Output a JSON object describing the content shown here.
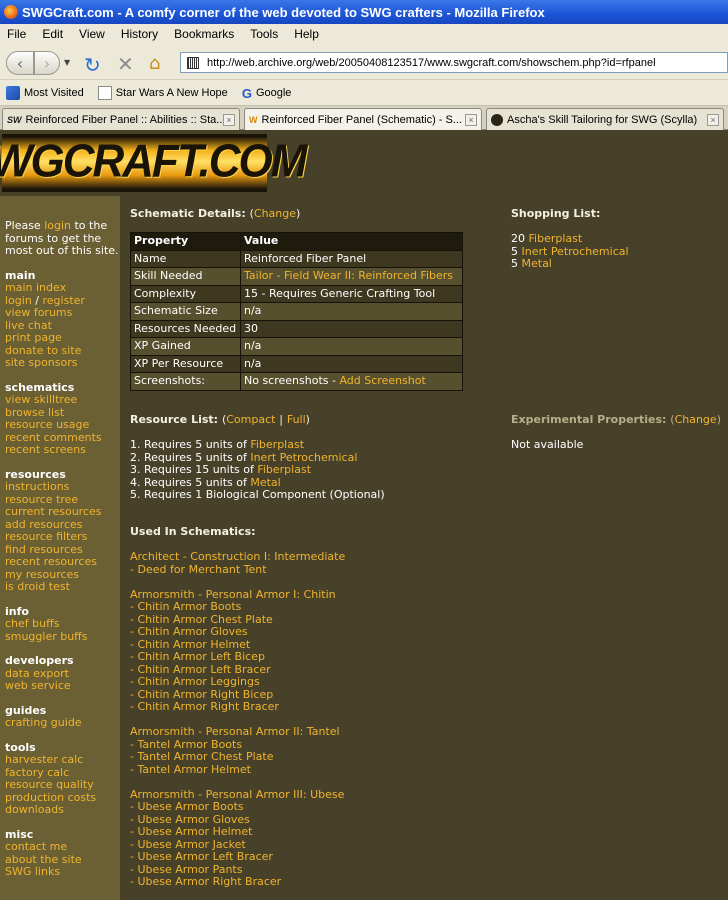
{
  "browser": {
    "window_title": "SWGCraft.com - A comfy corner of the web devoted to SWG crafters - Mozilla Firefox",
    "menu": [
      "File",
      "Edit",
      "View",
      "History",
      "Bookmarks",
      "Tools",
      "Help"
    ],
    "url": "http://web.archive.org/web/20050408123517/www.swgcraft.com/showschem.php?id=rfpanel",
    "bookmarks": [
      "Most Visited",
      "Star Wars A New Hope",
      "Google"
    ],
    "tabs": [
      {
        "fav": "SW",
        "title": "Reinforced Fiber Panel :: Abilities :: Sta..."
      },
      {
        "fav": "W",
        "title": "Reinforced Fiber Panel (Schematic) - S..."
      },
      {
        "fav": "",
        "title": "Ascha's Skill Tailoring for SWG (Scylla)"
      }
    ],
    "nav_glyphs": {
      "back": "‹",
      "forward": "›",
      "dropdown": "▼",
      "reload": "↻",
      "stop": "✕",
      "home": "⌂",
      "tab_close": "×"
    }
  },
  "site": {
    "logo_text": "SWGCRAFT.COM",
    "sidebar": {
      "intro_pre": "Please ",
      "intro_link": "login",
      "intro_post": " to the forums to get the most out of this site.",
      "sections": [
        {
          "title": "main",
          "items": [
            "main index",
            "login / register",
            "view forums",
            "live chat",
            "print page",
            "donate to site",
            "site sponsors"
          ]
        },
        {
          "title": "schematics",
          "items": [
            "view skilltree",
            "browse list",
            "resource usage",
            "recent comments",
            "recent screens"
          ]
        },
        {
          "title": "resources",
          "items": [
            "instructions",
            "resource tree",
            "current resources",
            "add resources",
            "resource filters",
            "find resources",
            "recent resources",
            "my resources",
            "is droid test"
          ]
        },
        {
          "title": "info",
          "items": [
            "chef buffs",
            "smuggler buffs"
          ]
        },
        {
          "title": "developers",
          "items": [
            "data export",
            "web service"
          ]
        },
        {
          "title": "guides",
          "items": [
            "crafting guide"
          ]
        },
        {
          "title": "tools",
          "items": [
            "harvester calc",
            "factory calc",
            "resource quality",
            "production costs",
            "downloads"
          ]
        },
        {
          "title": "misc",
          "items": [
            "contact me",
            "about the site",
            "SWG links"
          ]
        }
      ]
    },
    "details": {
      "heading": "Schematic Details:",
      "change_open": "(",
      "change": "Change",
      "change_close": ")",
      "col_property": "Property",
      "col_value": "Value",
      "rows": [
        {
          "p": "Name",
          "v": "Reinforced Fiber Panel",
          "link": ""
        },
        {
          "p": "Skill Needed",
          "v": "",
          "link": "Tailor - Field Wear II: Reinforced Fibers"
        },
        {
          "p": "Complexity",
          "v": "15 - Requires Generic Crafting Tool",
          "link": ""
        },
        {
          "p": "Schematic Size",
          "v": "n/a",
          "link": ""
        },
        {
          "p": "Resources Needed",
          "v": "30",
          "link": ""
        },
        {
          "p": "XP Gained",
          "v": "n/a",
          "link": ""
        },
        {
          "p": "XP Per Resource",
          "v": "n/a",
          "link": ""
        },
        {
          "p": "Screenshots:",
          "v": "No screenshots - ",
          "link": "Add Screenshot"
        }
      ]
    },
    "shopping": {
      "heading": "Shopping List:",
      "items": [
        {
          "qty": "20",
          "name": "Fiberplast"
        },
        {
          "qty": "5",
          "name": "Inert Petrochemical"
        },
        {
          "qty": "5",
          "name": "Metal"
        }
      ]
    },
    "resource_list": {
      "heading": "Resource List:",
      "opt_open": "(",
      "compact": "Compact",
      "sep": "|",
      "full": "Full",
      "opt_close": ")",
      "items": [
        {
          "pre": "1. Requires 5 units of ",
          "link": "Fiberplast"
        },
        {
          "pre": "2. Requires 5 units of ",
          "link": "Inert Petrochemical"
        },
        {
          "pre": "3. Requires 15 units of ",
          "link": "Fiberplast"
        },
        {
          "pre": "4. Requires 5 units of ",
          "link": "Metal"
        },
        {
          "pre": "5. Requires 1 Biological Component (Optional)",
          "link": ""
        }
      ]
    },
    "experimental": {
      "heading": "Experimental Properties:",
      "change_open": "(",
      "change": "Change",
      "change_close": ")",
      "value": "Not available"
    },
    "used_in": {
      "heading": "Used In Schematics:",
      "groups": [
        {
          "title": "Architect - Construction I: Intermediate",
          "items": [
            "- Deed for Merchant Tent"
          ]
        },
        {
          "title": "Armorsmith - Personal Armor I: Chitin",
          "items": [
            "- Chitin Armor Boots",
            "- Chitin Armor Chest Plate",
            "- Chitin Armor Gloves",
            "- Chitin Armor Helmet",
            "- Chitin Armor Left Bicep",
            "- Chitin Armor Left Bracer",
            "- Chitin Armor Leggings",
            "- Chitin Armor Right Bicep",
            "- Chitin Armor Right Bracer"
          ]
        },
        {
          "title": "Armorsmith - Personal Armor II: Tantel",
          "items": [
            "- Tantel Armor Boots",
            "- Tantel Armor Chest Plate",
            "- Tantel Armor Helmet"
          ]
        },
        {
          "title": "Armorsmith - Personal Armor III: Ubese",
          "items": [
            "- Ubese Armor Boots",
            "- Ubese Armor Gloves",
            "- Ubese Armor Helmet",
            "- Ubese Armor Jacket",
            "- Ubese Armor Left Bracer",
            "- Ubese Armor Pants",
            "- Ubese Armor Right Bracer"
          ]
        }
      ]
    }
  },
  "colors": {
    "link": "#f0b42d",
    "page_bg": "#47412a",
    "sidebar_bg": "#6b5f34"
  }
}
